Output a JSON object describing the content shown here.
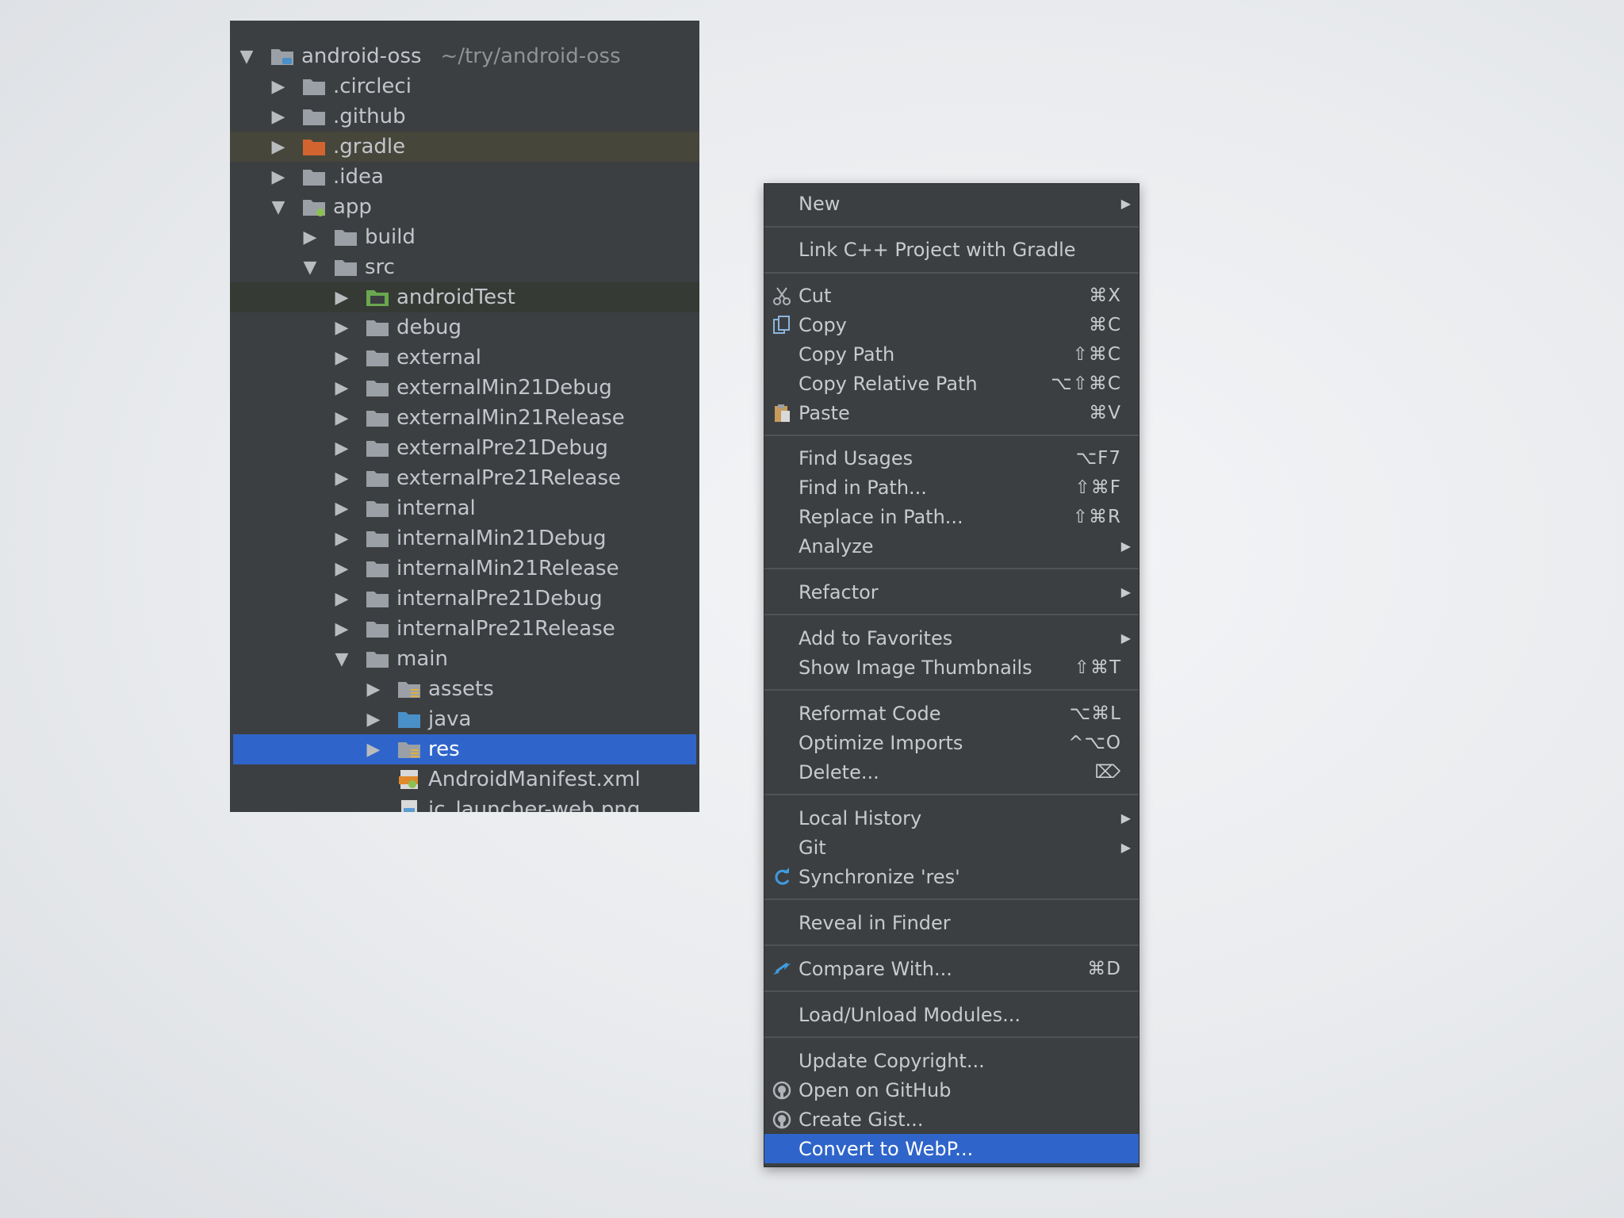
{
  "tree": {
    "root": {
      "name": "android-oss",
      "path": "~/try/android-oss"
    },
    "items": [
      {
        "label": ".circleci"
      },
      {
        "label": ".github"
      },
      {
        "label": ".gradle"
      },
      {
        "label": ".idea"
      },
      {
        "label": "app"
      },
      {
        "label": "build"
      },
      {
        "label": "src"
      },
      {
        "label": "androidTest"
      },
      {
        "label": "debug"
      },
      {
        "label": "external"
      },
      {
        "label": "externalMin21Debug"
      },
      {
        "label": "externalMin21Release"
      },
      {
        "label": "externalPre21Debug"
      },
      {
        "label": "externalPre21Release"
      },
      {
        "label": "internal"
      },
      {
        "label": "internalMin21Debug"
      },
      {
        "label": "internalMin21Release"
      },
      {
        "label": "internalPre21Debug"
      },
      {
        "label": "internalPre21Release"
      },
      {
        "label": "main"
      },
      {
        "label": "assets"
      },
      {
        "label": "java"
      },
      {
        "label": "res"
      },
      {
        "label": "AndroidManifest.xml"
      },
      {
        "label": "ic_launcher-web.png"
      }
    ]
  },
  "menu": {
    "items": [
      {
        "label": "New",
        "shortcut": ""
      },
      {
        "label": "Link C++ Project with Gradle",
        "shortcut": ""
      },
      {
        "label": "Cut",
        "shortcut": "⌘X"
      },
      {
        "label": "Copy",
        "shortcut": "⌘C"
      },
      {
        "label": "Copy Path",
        "shortcut": "⇧⌘C"
      },
      {
        "label": "Copy Relative Path",
        "shortcut": "⌥⇧⌘C"
      },
      {
        "label": "Paste",
        "shortcut": "⌘V"
      },
      {
        "label": "Find Usages",
        "shortcut": "⌥F7"
      },
      {
        "label": "Find in Path...",
        "shortcut": "⇧⌘F"
      },
      {
        "label": "Replace in Path...",
        "shortcut": "⇧⌘R"
      },
      {
        "label": "Analyze",
        "shortcut": ""
      },
      {
        "label": "Refactor",
        "shortcut": ""
      },
      {
        "label": "Add to Favorites",
        "shortcut": ""
      },
      {
        "label": "Show Image Thumbnails",
        "shortcut": "⇧⌘T"
      },
      {
        "label": "Reformat Code",
        "shortcut": "⌥⌘L"
      },
      {
        "label": "Optimize Imports",
        "shortcut": "^⌥O"
      },
      {
        "label": "Delete...",
        "shortcut": "⌦"
      },
      {
        "label": "Local History",
        "shortcut": ""
      },
      {
        "label": "Git",
        "shortcut": ""
      },
      {
        "label": "Synchronize 'res'",
        "shortcut": ""
      },
      {
        "label": "Reveal in Finder",
        "shortcut": ""
      },
      {
        "label": "Compare With...",
        "shortcut": "⌘D"
      },
      {
        "label": "Load/Unload Modules...",
        "shortcut": ""
      },
      {
        "label": "Update Copyright...",
        "shortcut": ""
      },
      {
        "label": "Open on GitHub",
        "shortcut": ""
      },
      {
        "label": "Create Gist...",
        "shortcut": ""
      },
      {
        "label": "Convert to WebP...",
        "shortcut": ""
      }
    ]
  },
  "colors": {
    "panel_bg": "#3c3f41",
    "selection": "#2f65ca",
    "folder_gray": "#9aa0a6",
    "folder_orange": "#d2652f",
    "folder_blue": "#4a90c8",
    "android_green": "#8cc152"
  }
}
